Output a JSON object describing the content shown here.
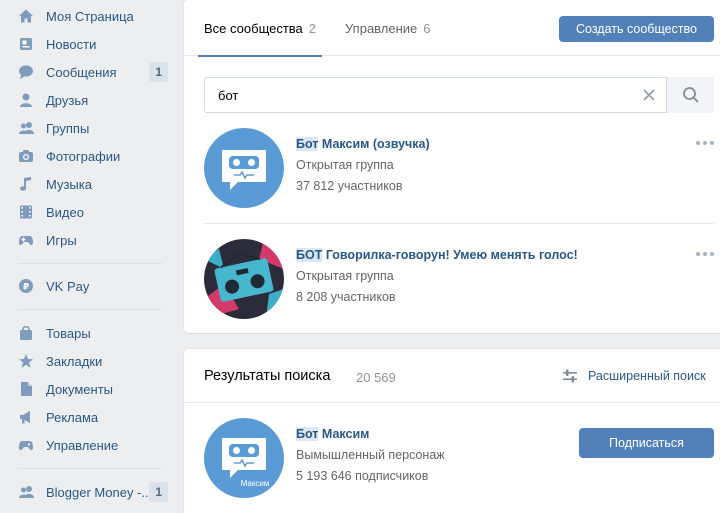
{
  "sidebar": {
    "items": [
      {
        "label": "Моя Страница",
        "icon": "home-icon"
      },
      {
        "label": "Новости",
        "icon": "news-icon"
      },
      {
        "label": "Сообщения",
        "icon": "messages-icon",
        "badge": "1"
      },
      {
        "label": "Друзья",
        "icon": "friends-icon"
      },
      {
        "label": "Группы",
        "icon": "groups-icon"
      },
      {
        "label": "Фотографии",
        "icon": "photos-icon"
      },
      {
        "label": "Музыка",
        "icon": "music-icon"
      },
      {
        "label": "Видео",
        "icon": "video-icon"
      },
      {
        "label": "Игры",
        "icon": "games-icon"
      },
      {
        "label": "VK Pay",
        "icon": "vkpay-icon"
      },
      {
        "label": "Товары",
        "icon": "market-icon"
      },
      {
        "label": "Закладки",
        "icon": "bookmarks-icon"
      },
      {
        "label": "Документы",
        "icon": "documents-icon"
      },
      {
        "label": "Реклама",
        "icon": "ads-icon"
      },
      {
        "label": "Управление",
        "icon": "gamepad-icon"
      },
      {
        "label": "Blogger Money -..",
        "icon": "community-icon",
        "badge": "1"
      }
    ]
  },
  "tabs": {
    "all": {
      "label": "Все сообщества",
      "count": "2"
    },
    "manage": {
      "label": "Управление",
      "count": "6"
    }
  },
  "create_button": "Создать сообщество",
  "search": {
    "value": "бот"
  },
  "communities": [
    {
      "name_highlight": "Бот",
      "name_rest": " Максим (озвучка)",
      "type": "Открытая группа",
      "members": "37 812 участников"
    },
    {
      "name_highlight": "БОТ",
      "name_rest": " Говорилка-говорун! Умею менять голос!",
      "type": "Открытая группа",
      "members": "8 208 участников"
    }
  ],
  "search_results": {
    "title": "Результаты поиска",
    "count": "20 569",
    "advanced_label": "Расширенный поиск",
    "items": [
      {
        "name_highlight": "Бот",
        "name_rest": " Максим",
        "type": "Вымышленный персонаж",
        "members": "5 193 646 подписчиков",
        "avatar_caption": "Максим",
        "button": "Подписаться"
      }
    ]
  },
  "colors": {
    "accent": "#5181b8",
    "link": "#2a5885",
    "avatar_bg": "#5b9bd5"
  }
}
